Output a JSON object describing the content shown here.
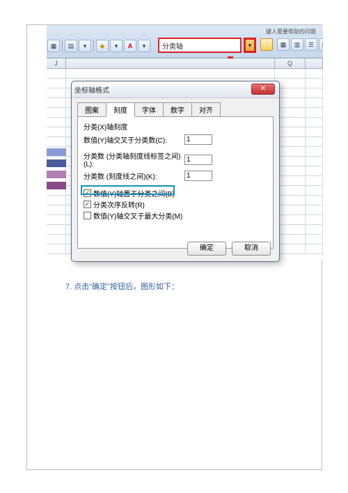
{
  "toolbar": {
    "help_hint": "键入需要帮助的问题",
    "dropdown_value": "分类轴",
    "letter_btn": "A"
  },
  "spreadsheet": {
    "col_j": "J",
    "col_q": "Q"
  },
  "dialog": {
    "title": "坐标轴格式",
    "tabs": {
      "t1": "图案",
      "t2": "刻度",
      "t3": "字体",
      "t4": "数字",
      "t5": "对齐"
    },
    "panel_title": "分类(X)轴刻度",
    "row1_label": "数值(Y)轴交叉于分类数(C):",
    "row1_val": "1",
    "row2_label": "分类数 (分类轴刻度线标签之间)(L):",
    "row2_val": "1",
    "row3_label": "分类数 (刻度线之间)(K):",
    "row3_val": "1",
    "chk1": "数值(Y)轴置于分类之间(B)",
    "chk2": "分类次序反转(R)",
    "chk3": "数值(Y)轴交叉于最大分类(M)",
    "ok": "确定",
    "cancel": "取消"
  },
  "caption": "7. 点击\"确定\"按钮后，图形如下："
}
